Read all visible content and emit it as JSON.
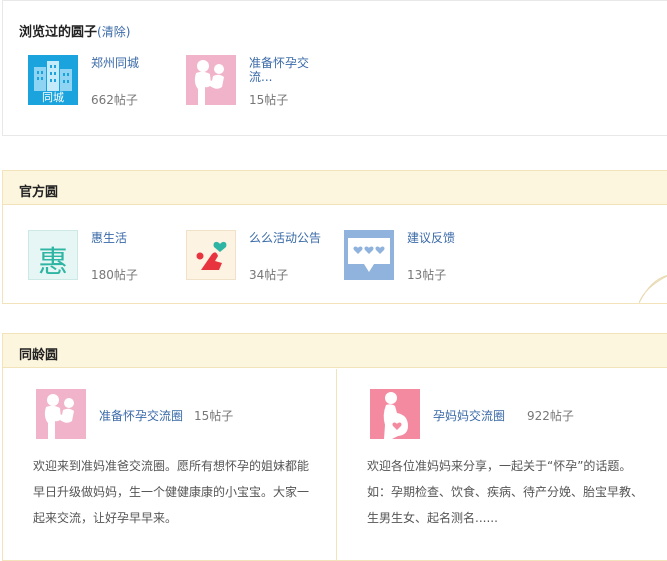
{
  "recent": {
    "title": "浏览过的圆子",
    "clear_label": "(清除)",
    "items": [
      {
        "name": "郑州同城",
        "count": "662帖子",
        "thumb_label": "同城",
        "icon": "city-buildings-icon"
      },
      {
        "name": "准备怀孕交流...",
        "count": "15帖子",
        "icon": "parent-child-silhouette-icon"
      }
    ]
  },
  "official": {
    "title": "官方圆",
    "items": [
      {
        "name": "惠生活",
        "count": "180帖子",
        "thumb_label": "惠",
        "icon": "hui-life-icon"
      },
      {
        "name": "么么活动公告",
        "count": "34帖子",
        "icon": "heart-activity-icon"
      },
      {
        "name": "建议反馈",
        "count": "13帖子",
        "icon": "speech-bubble-hearts-icon"
      }
    ]
  },
  "age": {
    "title": "同龄圆",
    "items": [
      {
        "name": "准备怀孕交流圈",
        "count": "15帖子",
        "icon": "parent-child-silhouette-icon",
        "desc": "欢迎来到准妈准爸交流圈。愿所有想怀孕的姐妹都能早日升级做妈妈，生一个健健康康的小宝宝。大家一起来交流，让好孕早早来。"
      },
      {
        "name": "孕妈妈交流圈",
        "count": "922帖子",
        "icon": "pregnant-woman-icon",
        "desc": "欢迎各位准妈妈来分享，一起关于“怀孕”的话题。如：孕期检查、饮食、疾病、待产分娩、胎宝早教、生男生女、起名测名......"
      }
    ]
  },
  "colors": {
    "link": "#3a6aa8",
    "header_bg": "#fdf6de",
    "border_yellow": "#f2e3ba"
  }
}
